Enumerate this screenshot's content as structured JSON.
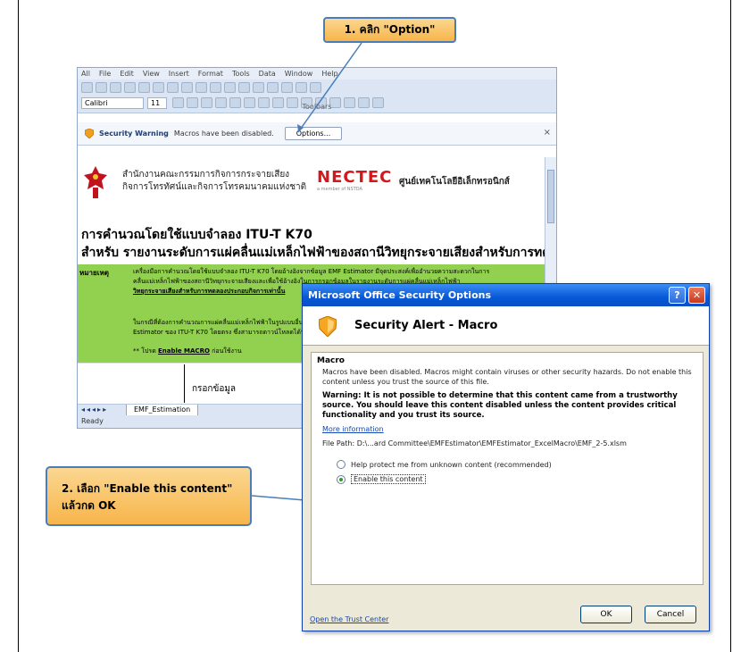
{
  "excel": {
    "menu": [
      "All",
      "File",
      "Edit",
      "View",
      "Insert",
      "Format",
      "Tools",
      "Data",
      "Window",
      "Help"
    ],
    "font_name": "Calibri",
    "font_size": "11",
    "toolbars_label": "Toolbars",
    "security_bar": {
      "title": "Security Warning",
      "message": "Macros have been disabled.",
      "options_button": "Options..."
    },
    "sheet": {
      "org_line1": "สำนักงานคณะกรรมการกิจการกระจายเสียง",
      "org_line2": "กิจการโทรทัศน์และกิจการโทรคมนาคมแห่งชาติ",
      "nectec_logo": "NECTEC",
      "nectec_sub": "a member of NSTDA",
      "nectec_thai": "ศูนย์เทคโนโลยีอิเล็กทรอนิกส์",
      "title_line1": "การคำนวณโดยใช้แบบจำลอง  ITU-T K70",
      "title_line2": "สำหรับ รายงานระดับการแผ่คลื่นแม่เหล็กไฟฟ้าของสถานีวิทยุกระจายเสียงสำหรับการทดลอง",
      "note_label": "หมายเหตุ",
      "note_line1": "เครื่องมือการคำนวณโดยใช้แบบจำลอง ITU-T K70 โดยอ้างอิงจากข้อมูล EMF Estimator มีจุดประสงค์เพื่ออำนวยความสะดวกในการ",
      "note_line2": "คลื่นแม่เหล็กไฟฟ้าของสถานีวิทยุกระจายเสียงและเพื่อใช้อ้างอิงในการกรอกข้อมูลในรายงานระดับการแผ่คลื่นแม่เหล็กไฟฟ้า",
      "note_line3": "วิทยุกระจายเสียงสำหรับการทดลองประกอบกิจการเท่านั้น",
      "note_line4": "ในกรณีที่ต้องการคำนวณการแผ่คลื่นแม่เหล็กไฟฟ้าในรูปแบบอื่น",
      "note_line5": "Estimator ของ ITU-T K70 โดยตรง ซึ่งสามารถดาวน์โหลดได้ที่",
      "note_line6_prefix": "** โปรด ",
      "note_line6_bold": "Enable MACRO",
      "note_line6_suffix": " ก่อนใช้งาน",
      "input_label": "กรอกข้อมูล"
    },
    "tab_name": "EMF_Estimation",
    "status": "Ready"
  },
  "callouts": {
    "step1": "1. คลิก \"Option\"",
    "step2_line1": "2. เลือก \"Enable this content\"",
    "step2_line2": "แล้วกด OK"
  },
  "dialog": {
    "title": "Microsoft Office Security Options",
    "heading": "Security Alert - Macro",
    "group_caption": "Macro",
    "description": "Macros have been disabled. Macros might contain viruses or other security hazards. Do not enable this content unless you trust the source of this file.",
    "warning": "Warning: It is not possible to determine that this content came from a trustworthy source. You should leave this content disabled unless the content provides critical functionality and you trust its source.",
    "more_info": "More information",
    "file_path": "File Path:  D:\\...ard Committee\\EMFEstimator\\EMFEstimator_ExcelMacro\\EMF_2-5.xlsm",
    "option_protect": "Help protect me from unknown content (recommended)",
    "option_enable": "Enable this content",
    "trust_center": "Open the Trust Center",
    "ok": "OK",
    "cancel": "Cancel"
  },
  "colors": {
    "callout_fill": "#f7b54a",
    "callout_border": "#4a7ebb",
    "sheet_note_bg": "#92d050",
    "dialog_title": "#0758d6",
    "nectec_red": "#d2181c"
  }
}
